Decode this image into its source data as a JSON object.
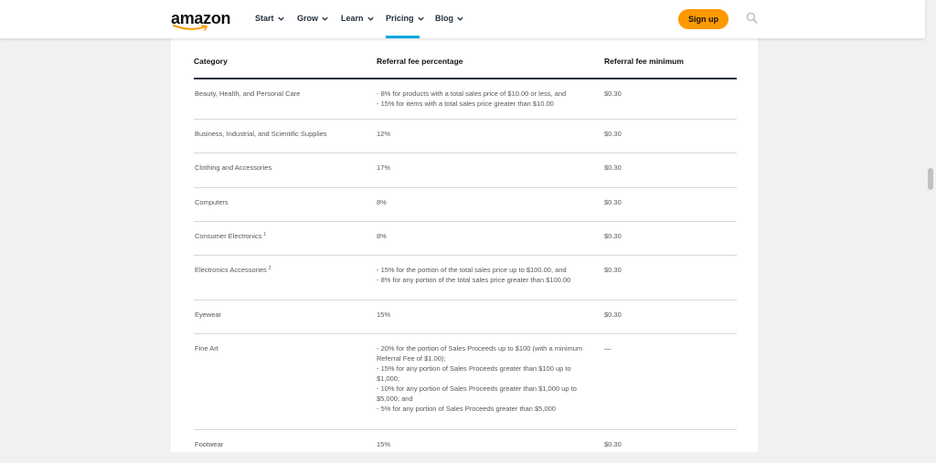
{
  "nav": {
    "logo_text": "amazon",
    "items": [
      {
        "label": "Start"
      },
      {
        "label": "Grow"
      },
      {
        "label": "Learn"
      },
      {
        "label": "Pricing"
      },
      {
        "label": "Blog"
      }
    ],
    "signup_label": "Sign up"
  },
  "table": {
    "headers": [
      "Category",
      "Referral fee percentage",
      "Referral fee minimum"
    ],
    "rows": [
      {
        "category": "Beauty, Health, and Personal Care",
        "sup": "",
        "fee_lines": [
          "- 8% for products with a total sales price of $10.00 or less, and",
          "- 15% for items with a total sales price greater than $10.00"
        ],
        "minimum": "$0.30"
      },
      {
        "category": "Business, Industrial, and Scientific Supplies",
        "sup": "",
        "fee_lines": [
          "12%"
        ],
        "minimum": "$0.30"
      },
      {
        "category": "Clothing and Accessories",
        "sup": "",
        "fee_lines": [
          "17%"
        ],
        "minimum": "$0.30"
      },
      {
        "category": "Computers",
        "sup": "",
        "fee_lines": [
          "8%"
        ],
        "minimum": "$0.30"
      },
      {
        "category": "Consumer Electronics",
        "sup": "1",
        "fee_lines": [
          "8%"
        ],
        "minimum": "$0.30"
      },
      {
        "category": "Electronics Accessories",
        "sup": "2",
        "fee_lines": [
          "- 15% for the portion of the total sales price up to $100.00, and",
          "- 8% for any portion of the total sales price greater than $100.00"
        ],
        "minimum": "$0.30"
      },
      {
        "category": "Eyewear",
        "sup": "",
        "fee_lines": [
          "15%"
        ],
        "minimum": "$0.30"
      },
      {
        "category": "Fine Art",
        "sup": "",
        "fee_lines": [
          "- 20% for the portion of Sales Proceeds up to $100 (with a minimum",
          "Referral Fee of $1.00);",
          "- 15% for any portion of Sales Proceeds greater than $100 up to",
          "$1,000;",
          "- 10% for any portion of Sales Proceeds greater than $1,000 up to",
          "$5,000; and",
          "- 5% for any portion of Sales Proceeds greater than $5,000"
        ],
        "minimum": "—"
      },
      {
        "category": "Footwear",
        "sup": "",
        "fee_lines": [
          "15%"
        ],
        "minimum": "$0.30"
      }
    ]
  },
  "colors": {
    "accent_underline": "#00a8e1",
    "signup_bg": "#ff9900",
    "text_dark": "#232f3e",
    "text_gray": "#565959"
  }
}
